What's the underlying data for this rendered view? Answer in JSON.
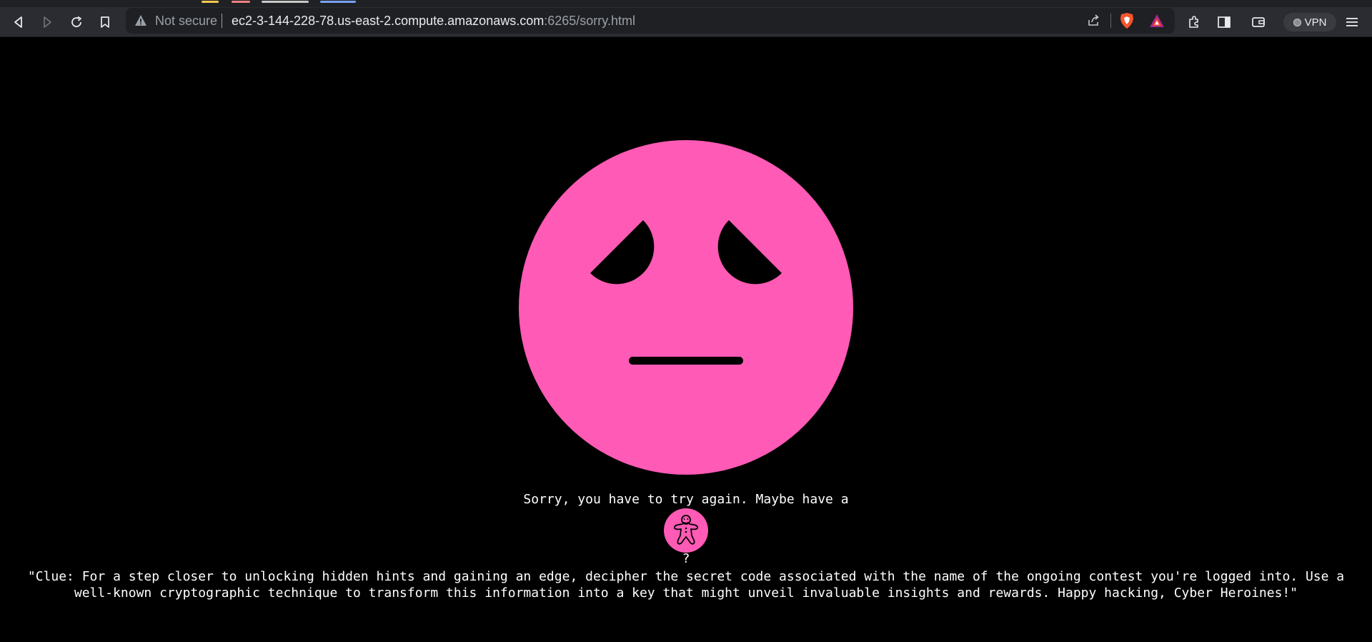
{
  "browser": {
    "security_label": "Not secure",
    "url_host": "ec2-3-144-228-78.us-east-2.compute.amazonaws.com",
    "url_rest": ":6265/sorry.html",
    "vpn_label": "VPN",
    "tab_hint_colors": [
      "#f9c74f",
      "#f08080",
      "#c8c8c8",
      "#7aa2f7"
    ]
  },
  "page": {
    "sorry_text": "Sorry, you have to try again. Maybe have a",
    "cookie_icon": "gingerbread-cookie-icon",
    "question_mark": "?",
    "clue_text": "\"Clue: For a step closer to unlocking hidden hints and gaining an edge, decipher the secret code associated with the name of the ongoing contest you're logged into. Use a well-known cryptographic technique to transform this information into a key that might unveil invaluable insights and rewards. Happy hacking, Cyber Heroines!\""
  },
  "colors": {
    "face": "#ff5ab5",
    "background": "#000000",
    "text": "#ffffff"
  }
}
